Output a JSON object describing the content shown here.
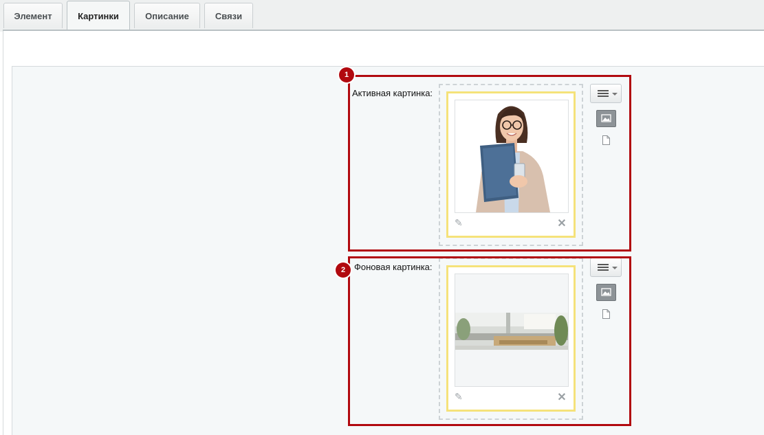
{
  "tabs": [
    {
      "label": "Элемент"
    },
    {
      "label": "Картинки"
    },
    {
      "label": "Описание"
    },
    {
      "label": "Связи"
    }
  ],
  "fields": [
    {
      "label": "Активная картинка:",
      "badge": "1"
    },
    {
      "label": "Фоновая картинка:",
      "badge": "2"
    }
  ],
  "icons": {
    "menu": "menu-icon",
    "image_mode": "image-icon",
    "file_mode": "file-icon",
    "edit": "pencil-icon",
    "delete": "close-icon"
  },
  "colors": {
    "highlight": "#b1090f",
    "card_border": "#f5e27a",
    "panel_bg": "#f5f8f9"
  }
}
